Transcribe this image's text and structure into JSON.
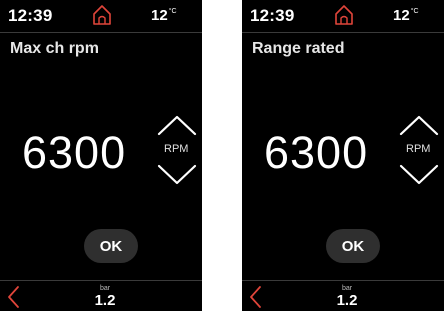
{
  "screens": [
    {
      "status": {
        "time": "12:39",
        "temperature": "12",
        "temperature_unit": "°C"
      },
      "title": "Max ch rpm",
      "value": "6300",
      "unit": "RPM",
      "ok_label": "OK",
      "footer": {
        "pressure_value": "1.2",
        "pressure_unit": "bar"
      }
    },
    {
      "status": {
        "time": "12:39",
        "temperature": "12",
        "temperature_unit": "°C"
      },
      "title": "Range rated",
      "value": "6300",
      "unit": "RPM",
      "ok_label": "OK",
      "footer": {
        "pressure_value": "1.2",
        "pressure_unit": "bar"
      }
    }
  ],
  "icons": {
    "home": "home-icon",
    "up": "chevron-up-icon",
    "down": "chevron-down-icon",
    "back": "chevron-left-icon"
  },
  "colors": {
    "accent": "#e0453a",
    "background": "#000000",
    "text": "#ffffff",
    "button": "#2f2f2f"
  }
}
